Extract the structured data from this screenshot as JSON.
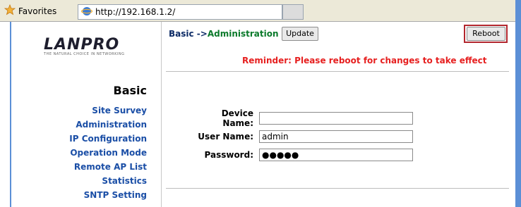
{
  "browser": {
    "favorites_label": "Favorites",
    "tab_url": "http://192.168.1.2/"
  },
  "logo": {
    "text": "LANPRO",
    "tagline": "THE NATURAL CHOICE IN NETWORKING"
  },
  "sidebar": {
    "title": "Basic",
    "items": [
      {
        "label": "Site Survey"
      },
      {
        "label": "Administration"
      },
      {
        "label": "IP Configuration"
      },
      {
        "label": "Operation Mode"
      },
      {
        "label": "Remote AP List"
      },
      {
        "label": "Statistics"
      },
      {
        "label": "SNTP Setting"
      }
    ]
  },
  "main": {
    "breadcrumb_prefix": "Basic ->",
    "breadcrumb_current": "Administration",
    "update_label": "Update",
    "reboot_label": "Reboot",
    "reminder": "Reminder: Please reboot for changes to take effect",
    "form": {
      "device_name_label": "Device Name:",
      "device_name_value": "",
      "user_name_label": "User Name:",
      "user_name_value": "admin",
      "password_label": "Password:",
      "password_value": "●●●●●"
    }
  },
  "colors": {
    "accent_blue": "#1a4ea6",
    "breadcrumb_green": "#0b7a2b",
    "reminder_red": "#e62020",
    "highlight_border": "#b2262e"
  }
}
